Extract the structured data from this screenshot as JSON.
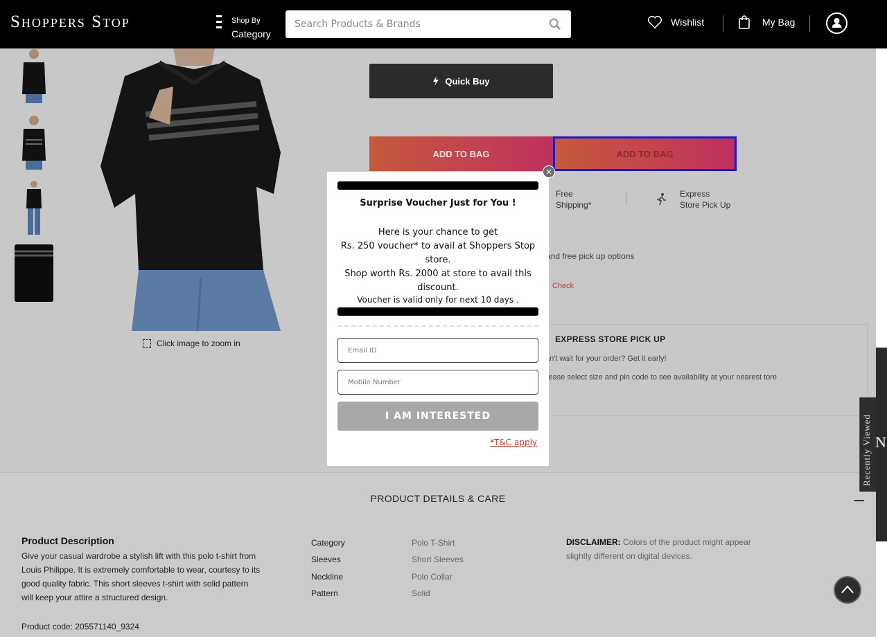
{
  "header": {
    "logo": "Shoppers Stop",
    "shop_by_label": "Shop By",
    "category_label": "Category",
    "search_placeholder": "Search Products & Brands",
    "wishlist_label": "Wishlist",
    "bag_label": "My Bag"
  },
  "gallery": {
    "zoom_hint": "Click image to zoom in"
  },
  "product": {
    "quick_buy_label": "Quick Buy",
    "add_to_bag_label": "ADD TO BAG",
    "add_to_bag_label_2": "ADD TO BAG",
    "free_shipping_line1": "Free",
    "free_shipping_line2": "Shipping*",
    "express_line1": "Express",
    "express_line2": "Store Pick Up",
    "delivery_text": "and free pick up options",
    "check_label": "Check"
  },
  "express_pickup": {
    "title": "EXPRESS STORE PICK UP",
    "line1": "an't wait for your order? Get it early!",
    "line2": "lease select size and pin code to see availability at your nearest tore"
  },
  "details": {
    "section_title": "PRODUCT DETAILS & CARE",
    "description_heading": "Product Description",
    "description_body": "Give your casual wardrobe a stylish lift with this polo t-shirt from Louis Philippe. It is extremely comfortable to wear, courtesy to its good quality fabric. This short sleeves t-shirt with solid pattern will keep your attire a structured design.",
    "product_code": "Product code: 205571140_9324",
    "attributes": [
      {
        "key": "Category",
        "value": "Polo T-Shirt"
      },
      {
        "key": "Sleeves",
        "value": "Short Sleeves"
      },
      {
        "key": "Neckline",
        "value": "Polo Collar"
      },
      {
        "key": "Pattern",
        "value": "Solid"
      }
    ],
    "disclaimer_label": "DISCLAIMER:",
    "disclaimer_text": " Colors of the product might appear slightly different on digital devices."
  },
  "side_tab": {
    "recently_viewed": "Recently Viewed",
    "letter": "N"
  },
  "modal": {
    "title": "Surprise Voucher Just for You !",
    "line1": "Here is your chance to get",
    "line2": "Rs. 250 voucher* to avail at Shoppers Stop store.",
    "line3": "Shop worth Rs. 2000 at store to avail this discount.",
    "line4": "Voucher is valid only for next 10 days .",
    "email_placeholder": "Email ID",
    "mobile_placeholder": "Mobile Number",
    "button_label": "I AM INTERESTED",
    "tnc_label": "*T&C apply",
    "close_glyph": "×"
  },
  "colors": {
    "header_bg": "#000000",
    "overlay_gray": "#c8c8c8",
    "add_to_bag_gradient_start": "#c65a3c",
    "add_to_bag_gradient_end": "#c0305f",
    "accent_red": "#c03a2b",
    "focus_outline": "#1a1ad6"
  },
  "icons": [
    "menu-icon",
    "search-icon",
    "heart-icon",
    "bag-icon",
    "user-icon",
    "lightning-icon",
    "walking-person-icon",
    "zoom-icon",
    "close-icon",
    "chevron-up-icon"
  ]
}
